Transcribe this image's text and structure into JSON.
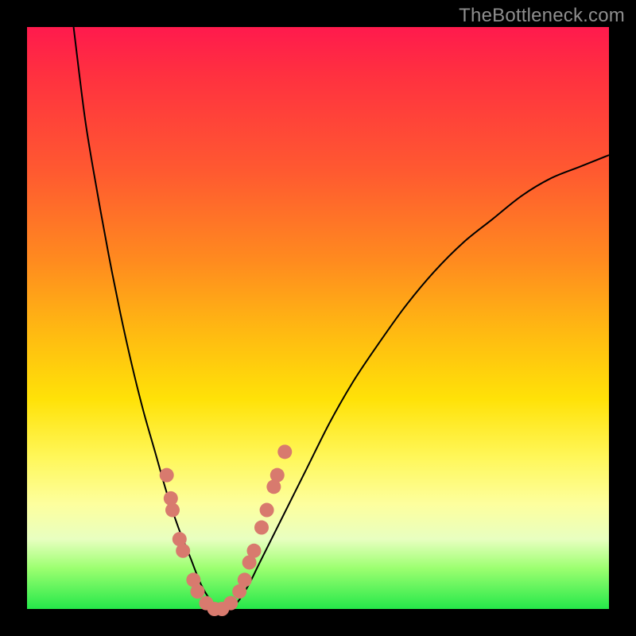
{
  "watermark": "TheBottleneck.com",
  "colors": {
    "background": "#000000",
    "gradient_top": "#ff1a4d",
    "gradient_mid": "#ffe208",
    "gradient_bottom": "#25e84a",
    "curve": "#000000",
    "markers": "#d87a6e"
  },
  "chart_data": {
    "type": "line",
    "title": "",
    "xlabel": "",
    "ylabel": "",
    "xlim": [
      0,
      100
    ],
    "ylim": [
      0,
      100
    ],
    "description": "V-shaped bottleneck curve with minimum near x≈30, rising steeply to the left (clipped at top edge around x≈8) and more gradually to the right, approaching ~78% height at x=100. Colored gradient background runs red (top, high bottleneck) → yellow → green (bottom, low bottleneck).",
    "curve": {
      "x": [
        8,
        10,
        12,
        14,
        16,
        18,
        20,
        22,
        24,
        26,
        28,
        30,
        32,
        34,
        36,
        38,
        40,
        44,
        48,
        52,
        56,
        60,
        65,
        70,
        75,
        80,
        85,
        90,
        95,
        100
      ],
      "y": [
        100,
        84,
        72,
        61,
        51,
        42,
        34,
        27,
        20,
        14,
        9,
        4,
        1,
        0,
        1,
        4,
        8,
        16,
        24,
        32,
        39,
        45,
        52,
        58,
        63,
        67,
        71,
        74,
        76,
        78
      ]
    },
    "markers": [
      {
        "x": 24.0,
        "y": 23
      },
      {
        "x": 24.7,
        "y": 19
      },
      {
        "x": 25.0,
        "y": 17
      },
      {
        "x": 26.2,
        "y": 12
      },
      {
        "x": 26.8,
        "y": 10
      },
      {
        "x": 28.6,
        "y": 5
      },
      {
        "x": 29.3,
        "y": 3
      },
      {
        "x": 30.8,
        "y": 1
      },
      {
        "x": 32.2,
        "y": 0
      },
      {
        "x": 33.5,
        "y": 0
      },
      {
        "x": 35.0,
        "y": 1
      },
      {
        "x": 36.5,
        "y": 3
      },
      {
        "x": 37.4,
        "y": 5
      },
      {
        "x": 38.2,
        "y": 8
      },
      {
        "x": 39.0,
        "y": 10
      },
      {
        "x": 40.3,
        "y": 14
      },
      {
        "x": 41.2,
        "y": 17
      },
      {
        "x": 42.4,
        "y": 21
      },
      {
        "x": 43.0,
        "y": 23
      },
      {
        "x": 44.3,
        "y": 27
      }
    ]
  }
}
